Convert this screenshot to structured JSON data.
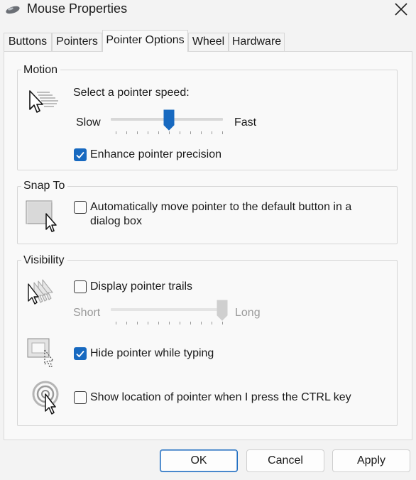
{
  "window": {
    "title": "Mouse Properties"
  },
  "tabs": [
    {
      "label": "Buttons"
    },
    {
      "label": "Pointers"
    },
    {
      "label": "Pointer Options"
    },
    {
      "label": "Wheel"
    },
    {
      "label": "Hardware"
    }
  ],
  "active_tab": "Pointer Options",
  "motion": {
    "title": "Motion",
    "speed_label": "Select a pointer speed:",
    "slow_label": "Slow",
    "fast_label": "Fast",
    "speed_level": 0.5,
    "enhance_precision": {
      "label": "Enhance pointer precision",
      "checked": true
    }
  },
  "snap_to": {
    "title": "Snap To",
    "auto_move": {
      "label_line1": "Automatically move pointer to the default button in a",
      "label_line2": "dialog box",
      "checked": false
    }
  },
  "visibility": {
    "title": "Visibility",
    "trails": {
      "label": "Display pointer trails",
      "checked": false
    },
    "short_label": "Short",
    "long_label": "Long",
    "trail_level": 1.0,
    "hide_typing": {
      "label": "Hide pointer while typing",
      "checked": true
    },
    "show_location": {
      "label": "Show location of pointer when I press the CTRL key",
      "checked": false
    }
  },
  "buttons": {
    "ok": "OK",
    "cancel": "Cancel",
    "apply": "Apply"
  },
  "colors": {
    "accent": "#1769c0",
    "background": "#f3f3f3",
    "panel": "#f9f9f9"
  }
}
